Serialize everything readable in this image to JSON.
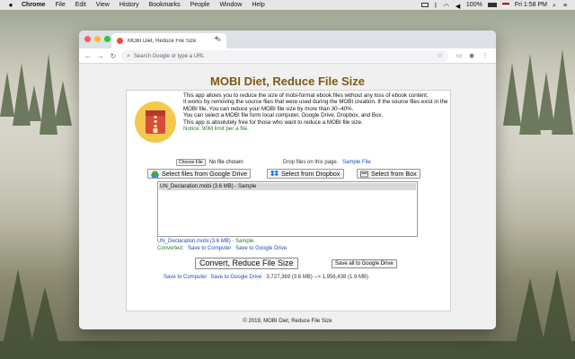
{
  "menubar": {
    "app_name": "Chrome",
    "items": [
      "File",
      "Edit",
      "View",
      "History",
      "Bookmarks",
      "People",
      "Window",
      "Help"
    ],
    "battery": "100%",
    "clock": "Fri 1:58 PM"
  },
  "browser": {
    "tab_title": "MOBI Diet, Reduce File Size",
    "new_tab": "+",
    "omnibox_placeholder": "Search Google or type a URL"
  },
  "page": {
    "title": "MOBI Diet, Reduce File Size",
    "description": [
      "This app allows you to reduce the size of mobi-format ebook files without any loss of ebook content.",
      "It works by removing the source files that were used during the MOBI creation. If the source files exist in the MOBI file, You can reduce your MOBI file size by more than 30~40%.",
      "You can select a MOBI file form local computer, Google Drive, Dropbox, and Box.",
      "This app is absolutely free for those who want to reduce a MOBI file size."
    ],
    "notice": "Notice: 90M limit per a file.",
    "choose_file_label": "Choose File",
    "no_file_text": "No file chosen",
    "drop_text": "Drop files on this page.",
    "sample_file_link": "Sample File",
    "buttons": {
      "google_drive": "Select files from Google Drive",
      "dropbox": "Select from Dropbox",
      "box": "Select from Box"
    },
    "list_items": [
      "UN_Declaration.mobi (3.6 MB) - Sample"
    ],
    "file_info_name": "UN_Declaration.mobi (3.6 MB)",
    "file_info_suffix": " - Sample",
    "converted_label": "Converted:",
    "save_to_computer": "Save to Computer",
    "save_to_google_drive": "Save to Google Drive",
    "convert_button": "Convert, Reduce File Size",
    "save_all_button": "Save all to Google Drive",
    "size_result": "3,727,369 (3.6 MB) --> 1,956,438 (1.9 MB)",
    "footer": "© 2019, MOBI Diet, Reduce File Size"
  },
  "colors": {
    "title": "#7a5a14",
    "link": "#1a4fb0",
    "green": "#2a7a2a",
    "close": "#ff5f57",
    "minimize": "#febc2e",
    "maximize": "#28c840"
  }
}
